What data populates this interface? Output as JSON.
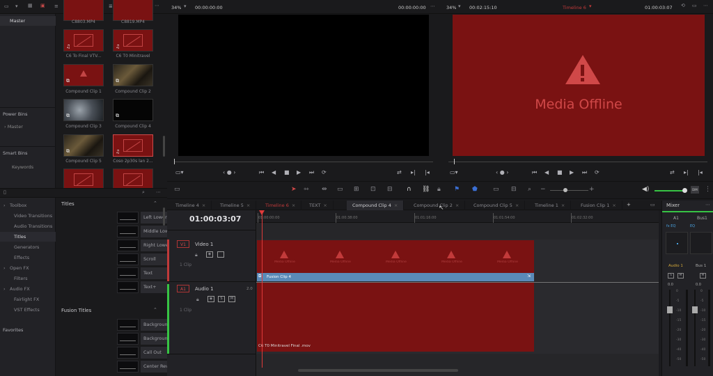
{
  "colors": {
    "accent_red": "#7a1212",
    "offline_text": "#c23a3a",
    "audio_green": "#37c444",
    "clip_blue": "#5a8ab8"
  },
  "media_pool": {
    "master_label": "Master",
    "clips": [
      {
        "caption": "C8803.MP4"
      },
      {
        "caption": "C8819.MP4"
      },
      {
        "caption": "C6 To Final VTV..."
      },
      {
        "caption": "C6 T0 Minitravel"
      },
      {
        "caption": "Compound Clip 1"
      },
      {
        "caption": "Compound Clip 2"
      },
      {
        "caption": "Compound Clip 3"
      },
      {
        "caption": "Compound Clip 4"
      },
      {
        "caption": "Compound Clip 5"
      },
      {
        "caption": "Coso 2p30s lan 2..."
      }
    ],
    "power_bins": "Power Bins",
    "power_master": "Master",
    "smart_bins": "Smart Bins",
    "keywords": "Keywords"
  },
  "toolbar": {
    "source_zoom": "34%",
    "source_tc": "00:00:00:00",
    "source_tc2": "00:00:00:00",
    "program_zoom": "34%",
    "program_duration": "00:02:15:10",
    "timeline_name": "Timeline 6",
    "program_tc": "01:00:03:07"
  },
  "viewer": {
    "offline_message": "Media Offline"
  },
  "effects": {
    "tree": [
      {
        "label": "Toolbox",
        "level": 0
      },
      {
        "label": "Video Transitions",
        "level": 1
      },
      {
        "label": "Audio Transitions",
        "level": 1
      },
      {
        "label": "Titles",
        "level": 1,
        "selected": true
      },
      {
        "label": "Generators",
        "level": 1
      },
      {
        "label": "Effects",
        "level": 1
      },
      {
        "label": "Open FX",
        "level": 0
      },
      {
        "label": "Filters",
        "level": 1
      },
      {
        "label": "Audio FX",
        "level": 0
      },
      {
        "label": "Fairlight FX",
        "level": 1
      },
      {
        "label": "VST Effects",
        "level": 1
      }
    ],
    "favorites": "Favorites",
    "titles_header": "Titles",
    "titles": [
      "Left Lower Third",
      "Middle Lower Third",
      "Right Lower Third",
      "Scroll",
      "Text",
      "Text+"
    ],
    "fusion_header": "Fusion Titles",
    "fusion_titles": [
      "Background Reveal",
      "Background Reveal Lower Th...",
      "Call Out",
      "Center Reveal"
    ]
  },
  "timeline": {
    "tabs": [
      "Timeline 4",
      "Timeline 5",
      "Timeline 6",
      "TEXT",
      "Compound Clip 4",
      "Compound Clip 2",
      "Compound Clip 5",
      "Timeline 1",
      "Fusion Clip 1"
    ],
    "timecode": "01:00:03:07",
    "ruler": [
      "01:00:00:00",
      "01:00:38:00",
      "01:01:16:00",
      "01:01:54:00",
      "01:02:32:00"
    ],
    "video_track": {
      "id": "V1",
      "name": "Video 1",
      "clip_count": "1 Clip"
    },
    "audio_track": {
      "id": "A1",
      "name": "Audio 1",
      "level": "2.0",
      "clip_count": "1 Clip"
    },
    "offline_label": "Media Offline",
    "fusion_clip": "Fusion Clip 4",
    "audio_clip": "C6 T0 Minitravel Final .mov"
  },
  "mixer": {
    "title": "Mixer",
    "ch1": "A1",
    "ch2": "Bus1",
    "ch1_name": "Audio 1",
    "ch2_name": "Bus 1",
    "val1": "0.0",
    "val2": "0.0",
    "scale": [
      "0",
      "-5",
      "-10",
      "-15",
      "-20",
      "-30",
      "-40",
      "-50"
    ]
  }
}
